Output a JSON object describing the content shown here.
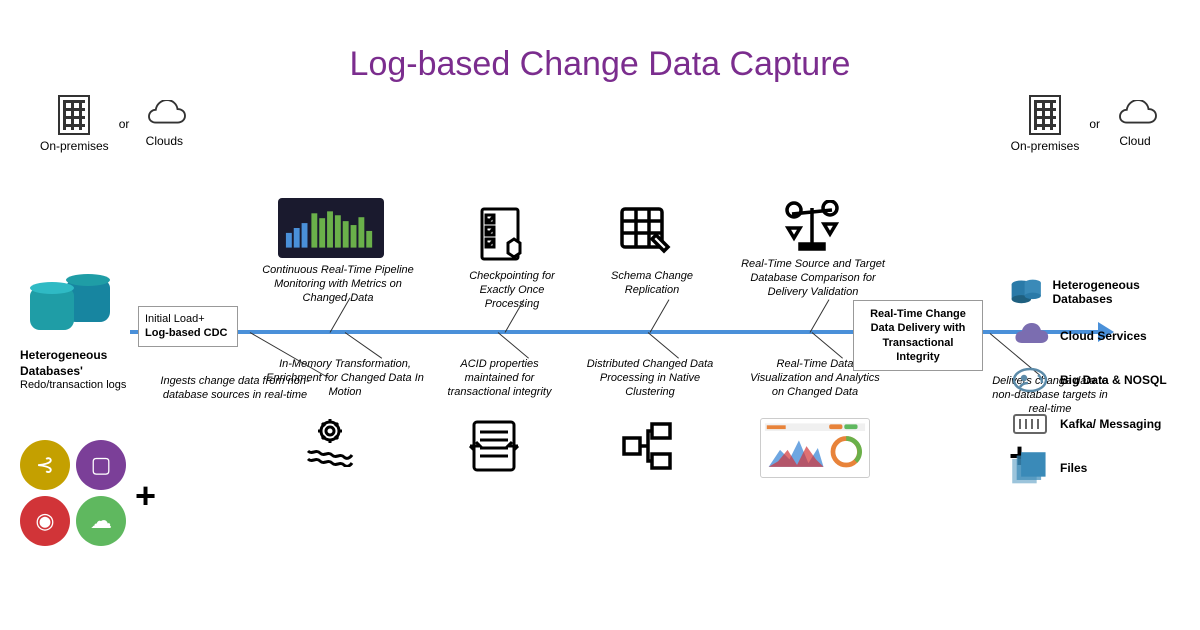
{
  "title": "Log-based Change Data Capture",
  "deploy": {
    "onprem": "On-premises",
    "cloud_left": "Clouds",
    "cloud_right": "Cloud",
    "or": "or"
  },
  "source": {
    "heading": "Heterogeneous Databases'",
    "sub": "Redo/transaction logs"
  },
  "badges": {
    "initial_load_line1": "Initial Load+",
    "initial_load_line2": "Log-based CDC",
    "delivery": "Real-Time Change Data Delivery with Transactional Integrity"
  },
  "features": {
    "ingest": "Ingests change data from non-database sources in real-time",
    "monitoring": "Continuous Real-Time Pipeline Monitoring with Metrics on Changed Data",
    "transform": "In-Memory Transformation, Enrichment for Changed Data In Motion",
    "checkpoint": "Checkpointing for Exactly Once Processing",
    "acid": "ACID properties maintained for transactional integrity",
    "schema": "Schema Change Replication",
    "cluster": "Distributed  Changed Data Processing in Native Clustering",
    "compare": "Real-Time Source and Target Database Comparison for Delivery Validation",
    "visualize": "Real-Time Data Visualization and Analytics on Changed Data",
    "deliver": "Delivers change data to non-database targets in real-time"
  },
  "targets": {
    "db": "Heterogeneous Databases",
    "cloud": "Cloud Services",
    "bigdata": "Big Data & NOSQL",
    "kafka": "Kafka/ Messaging",
    "files": "Files"
  },
  "icons": {
    "kafka_src": "kafka",
    "doc_src": "document",
    "wifi_src": "wifi",
    "cloud_src": "cloud"
  }
}
